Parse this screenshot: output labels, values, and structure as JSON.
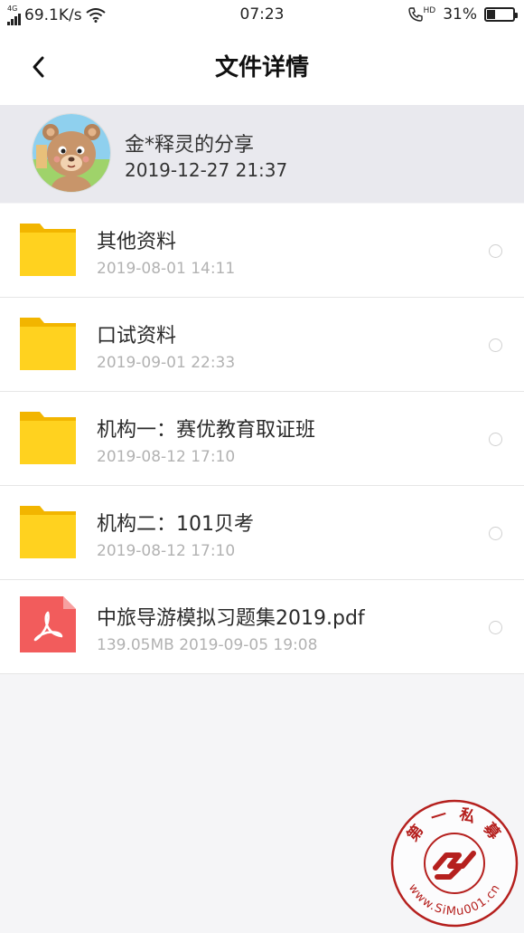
{
  "status_bar": {
    "network": "4G",
    "speed": "69.1K/s",
    "time": "07:23",
    "call_badge": "HD",
    "battery_percent": "31%",
    "battery_level": 0.31
  },
  "nav": {
    "title": "文件详情"
  },
  "share": {
    "sharer": "金*释灵的分享",
    "timestamp": "2019-12-27  21:37"
  },
  "files": [
    {
      "type": "folder",
      "name": "其他资料",
      "meta": "2019-08-01  14:11",
      "icon": "folder-icon"
    },
    {
      "type": "folder",
      "name": "口试资料",
      "meta": "2019-09-01  22:33",
      "icon": "folder-icon"
    },
    {
      "type": "folder",
      "name": "机构一：赛优教育取证班",
      "meta": "2019-08-12  17:10",
      "icon": "folder-icon"
    },
    {
      "type": "folder",
      "name": "机构二：101贝考",
      "meta": "2019-08-12  17:10",
      "icon": "folder-icon"
    },
    {
      "type": "pdf",
      "name": "中旅导游模拟习题集2019.pdf",
      "meta": "139.05MB   2019-09-05  19:08",
      "icon": "pdf-icon"
    }
  ],
  "watermark": {
    "top_text": "第 一 私 募",
    "url_text": "www.SiMu001.cn"
  },
  "colors": {
    "folder": "#FFD21F",
    "folder_tab": "#F2B500",
    "pdf": "#F25C5C",
    "header_bg": "#E9E9EE",
    "watermark": "#B5201E"
  }
}
